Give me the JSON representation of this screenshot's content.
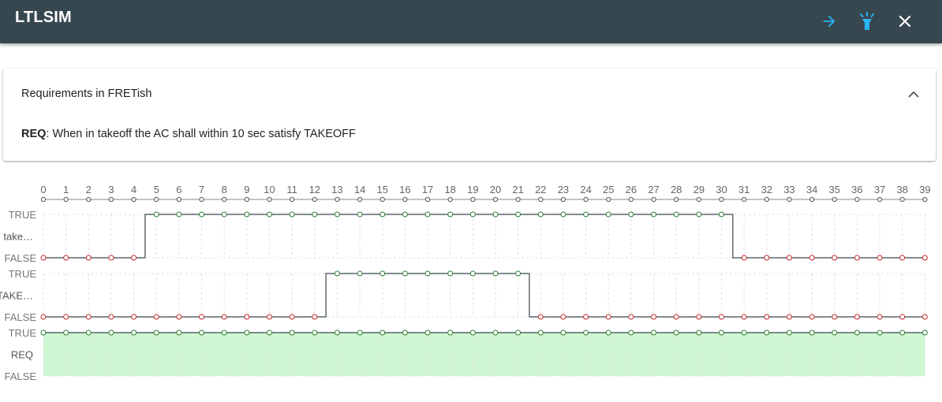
{
  "app": {
    "title": "LTLSIM",
    "actions": [
      {
        "name": "forward-arrow-icon",
        "color": "#29b6f6"
      },
      {
        "name": "lightbulb-icon",
        "color": "#29b6f6"
      },
      {
        "name": "close-icon",
        "color": "#ffffff"
      }
    ]
  },
  "requirements_panel": {
    "title": "Requirements in FRETish",
    "req_id": "REQ",
    "req_text": ": When in takeoff the AC shall within 10 sec satisfy TAKEOFF"
  },
  "timeline": {
    "ticks": [
      "0",
      "1",
      "2",
      "3",
      "4",
      "5",
      "6",
      "7",
      "8",
      "9",
      "10",
      "11",
      "12",
      "13",
      "14",
      "15",
      "16",
      "17",
      "18",
      "19",
      "20",
      "21",
      "22",
      "23",
      "24",
      "25",
      "26",
      "27",
      "28",
      "29",
      "30",
      "31",
      "32",
      "33",
      "34",
      "35",
      "36",
      "37",
      "38",
      "39"
    ],
    "true_label": "TRUE",
    "false_label": "FALSE",
    "colors": {
      "true_point": "#2e7d32",
      "false_point": "#c62828",
      "line": "#37474f",
      "req_fill": "#cff7d3"
    },
    "signals": [
      {
        "label": "take…",
        "values": [
          0,
          0,
          0,
          0,
          0,
          1,
          1,
          1,
          1,
          1,
          1,
          1,
          1,
          1,
          1,
          1,
          1,
          1,
          1,
          1,
          1,
          1,
          1,
          1,
          1,
          1,
          1,
          1,
          1,
          1,
          1,
          0,
          0,
          0,
          0,
          0,
          0,
          0,
          0,
          0
        ]
      },
      {
        "label": "TAKE…",
        "values": [
          0,
          0,
          0,
          0,
          0,
          0,
          0,
          0,
          0,
          0,
          0,
          0,
          0,
          1,
          1,
          1,
          1,
          1,
          1,
          1,
          1,
          1,
          0,
          0,
          0,
          0,
          0,
          0,
          0,
          0,
          0,
          0,
          0,
          0,
          0,
          0,
          0,
          0,
          0,
          0
        ]
      }
    ],
    "requirement": {
      "label": "REQ",
      "values": [
        1,
        1,
        1,
        1,
        1,
        1,
        1,
        1,
        1,
        1,
        1,
        1,
        1,
        1,
        1,
        1,
        1,
        1,
        1,
        1,
        1,
        1,
        1,
        1,
        1,
        1,
        1,
        1,
        1,
        1,
        1,
        1,
        1,
        1,
        1,
        1,
        1,
        1,
        1,
        1
      ]
    }
  }
}
